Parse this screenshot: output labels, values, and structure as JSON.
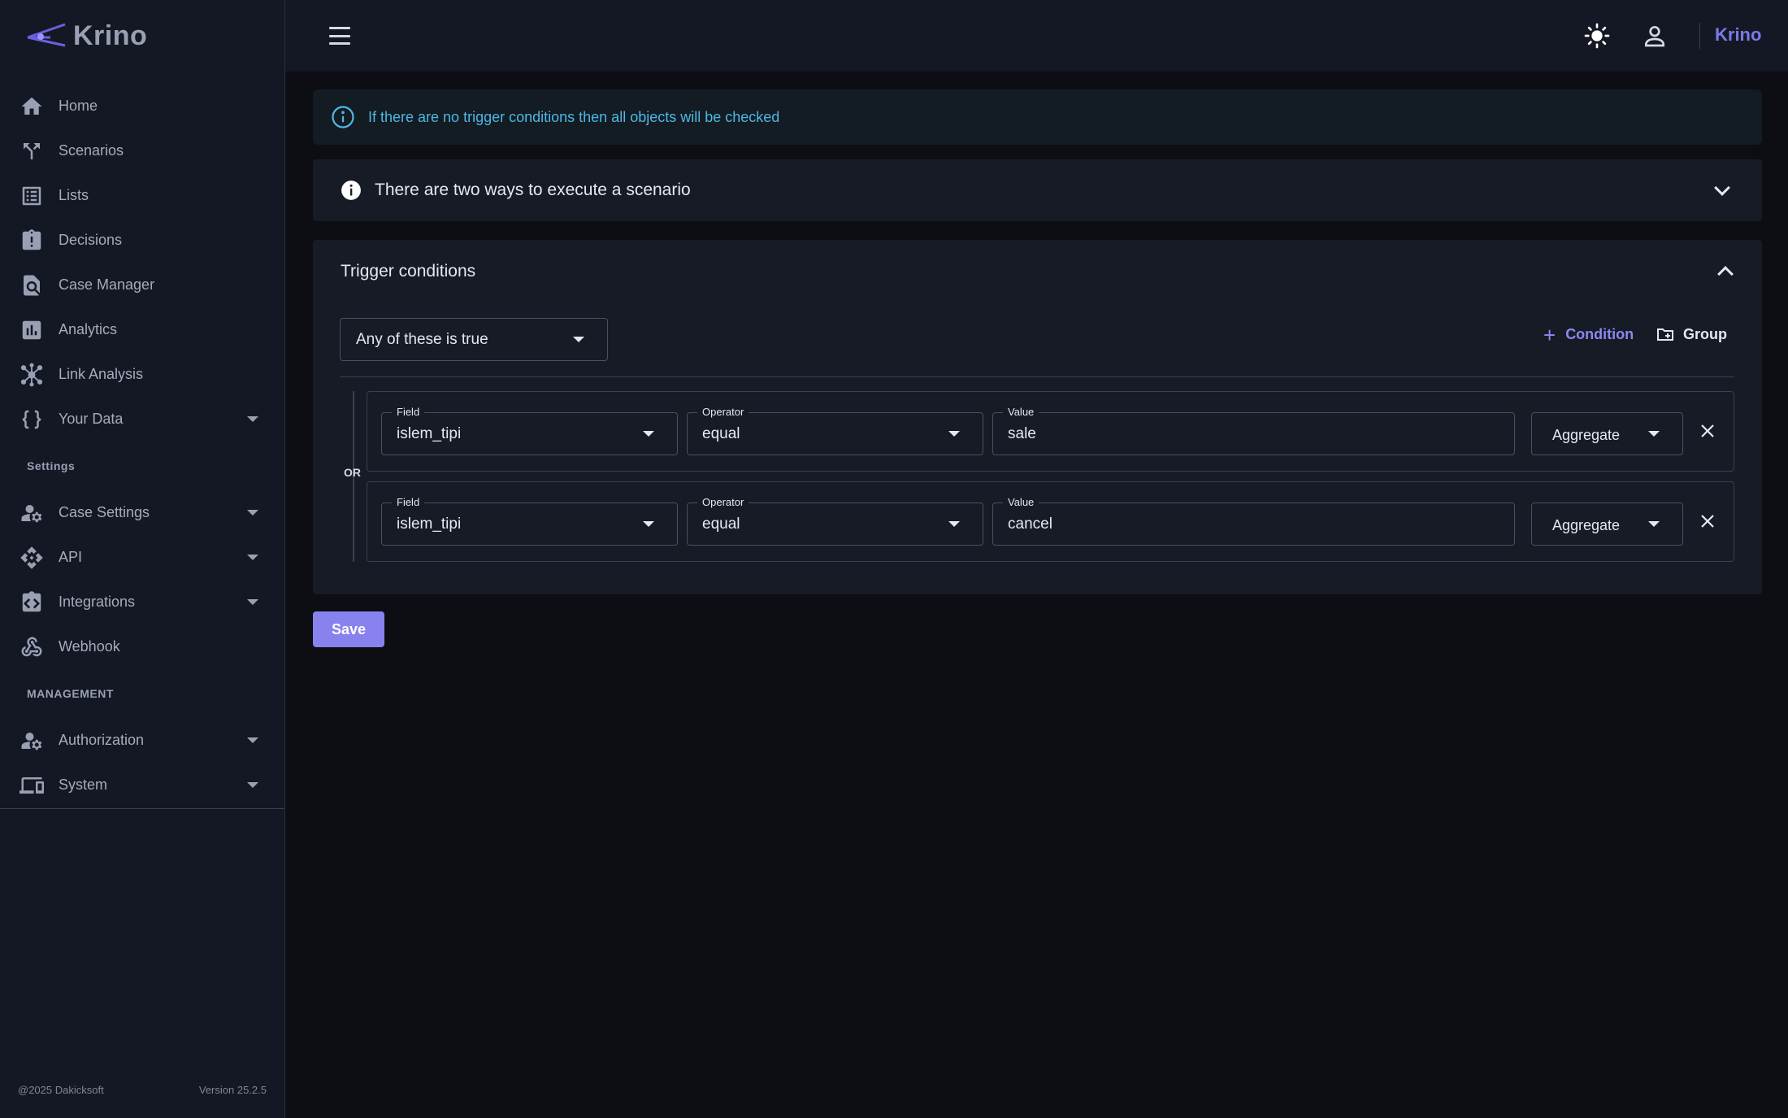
{
  "brand": {
    "logo_text": "Krino",
    "top_link": "Krino"
  },
  "sidebar": {
    "items": [
      {
        "label": "Home",
        "icon": "home-icon"
      },
      {
        "label": "Scenarios",
        "icon": "fork-icon"
      },
      {
        "label": "Lists",
        "icon": "list-icon"
      },
      {
        "label": "Decisions",
        "icon": "clipboard-alert-icon"
      },
      {
        "label": "Case Manager",
        "icon": "search-document-icon"
      },
      {
        "label": "Analytics",
        "icon": "bar-chart-icon"
      },
      {
        "label": "Link Analysis",
        "icon": "hub-icon"
      },
      {
        "label": "Your Data",
        "icon": "braces-icon"
      }
    ],
    "settings_title": "Settings",
    "settings_items": [
      {
        "label": "Case Settings",
        "icon": "user-gear-icon"
      },
      {
        "label": "API",
        "icon": "api-icon"
      },
      {
        "label": "Integrations",
        "icon": "integrations-icon"
      },
      {
        "label": "Webhook",
        "icon": "webhook-icon"
      }
    ],
    "management_title": "MANAGEMENT",
    "management_items": [
      {
        "label": "Authorization",
        "icon": "user-gear-icon"
      },
      {
        "label": "System",
        "icon": "devices-icon"
      }
    ],
    "footer_copyright": "@2025 Dakicksoft",
    "footer_version": "Version 25.2.5"
  },
  "info_banner": "If there are no trigger conditions then all objects will be checked",
  "accordion_title": "There are two ways to execute a scenario",
  "trigger": {
    "title": "Trigger conditions",
    "match_select": "Any of these is true",
    "add_condition": "Condition",
    "add_group": "Group",
    "logic_label": "OR",
    "conditions": [
      {
        "field_label": "Field",
        "field": "islem_tipi",
        "operator_label": "Operator",
        "operator": "equal",
        "value_label": "Value",
        "value": "sale",
        "aggregate": "Aggregate"
      },
      {
        "field_label": "Field",
        "field": "islem_tipi",
        "operator_label": "Operator",
        "operator": "equal",
        "value_label": "Value",
        "value": "cancel",
        "aggregate": "Aggregate"
      }
    ]
  },
  "save_label": "Save",
  "colors": {
    "accent": "#8882ee",
    "info": "#4fb6e6",
    "sidebar_bg": "#141824",
    "page_bg": "#0c0e13"
  }
}
